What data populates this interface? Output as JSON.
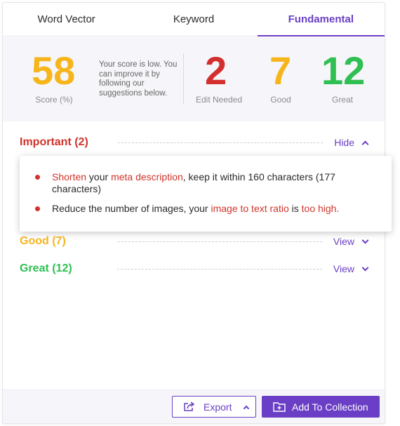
{
  "tabs": [
    {
      "label": "Word Vector"
    },
    {
      "label": "Keyword"
    },
    {
      "label": "Fundamental"
    }
  ],
  "scores": {
    "score_value": "58",
    "score_label": "Score (%)",
    "note": "Your score is low. You can improve it by following our suggestions below.",
    "edit_value": "2",
    "edit_label": "Edit Needed",
    "good_value": "7",
    "good_label": "Good",
    "great_value": "12",
    "great_label": "Great"
  },
  "sections": {
    "important": {
      "title": "Important (2)",
      "toggle": "Hide"
    },
    "good": {
      "title": "Good (7)",
      "toggle": "View"
    },
    "great": {
      "title": "Great (12)",
      "toggle": "View"
    }
  },
  "suggestions": {
    "item1": {
      "part1": "Shorten",
      "part2": " your ",
      "part3": "meta description",
      "part4": ", keep it within 160 characters (177 characters)"
    },
    "item2": {
      "part1": "Reduce the number of images, your ",
      "part2": "image to text ratio",
      "part3": " is ",
      "part4": "too high."
    }
  },
  "footer": {
    "export_label": "Export",
    "add_label": "Add To Collection"
  },
  "colors": {
    "accent": "#6a3fc5",
    "score_orange": "#f7b51c",
    "edit_red": "#d32f2f",
    "good_yellow": "#f7b51c",
    "great_green": "#2fbf52",
    "important_red": "#d0342c"
  },
  "icons": {
    "export": "share-export-icon",
    "add": "folder-plus-icon",
    "expand": "chevron-up-icon",
    "collapse": "chevron-down-icon"
  }
}
